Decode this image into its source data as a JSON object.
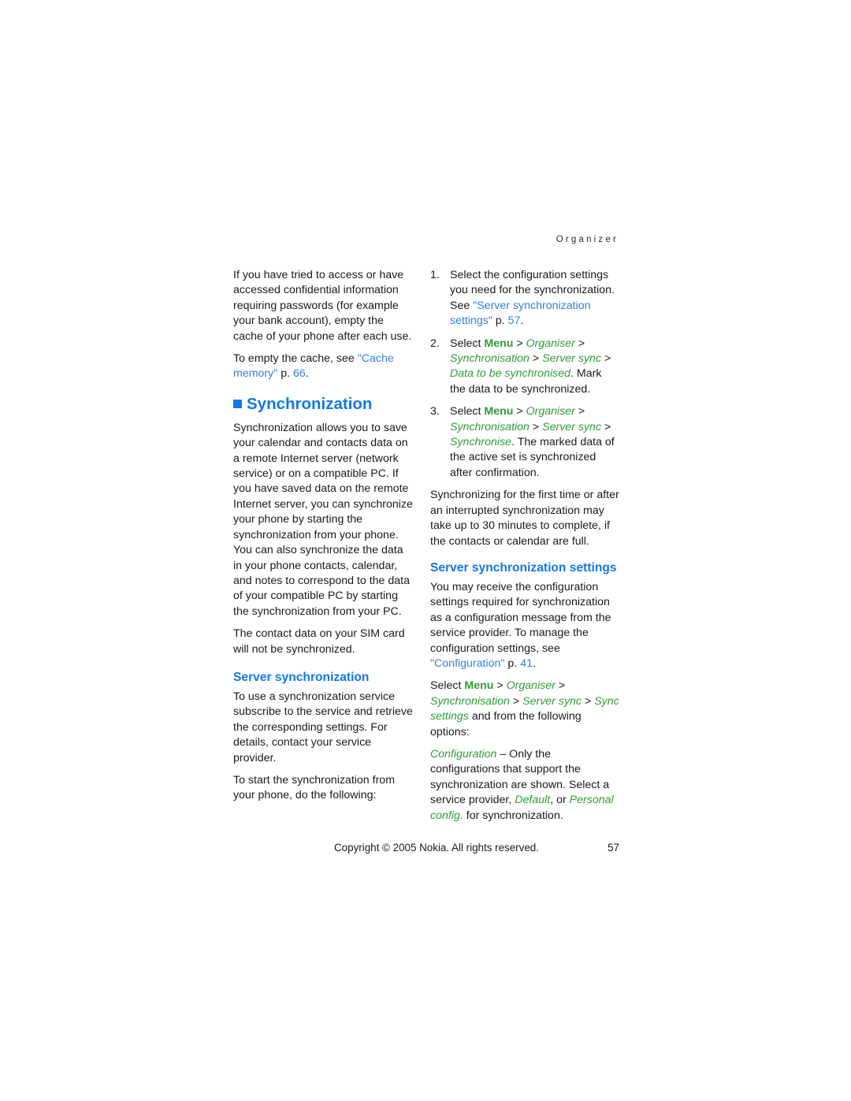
{
  "running_head": "Organizer",
  "colors": {
    "heading_blue": "#1277e8",
    "link_blue": "#3080d8",
    "menu_green": "#2f9b35",
    "body_text": "#1a1a1a",
    "page_background": "#ffffff"
  },
  "left_column": {
    "para_cache_warning": "If you have tried to access or have accessed confidential information requiring passwords (for example your bank account), empty the cache of your phone after each use.",
    "para_empty_cache": {
      "pre": "To empty the cache, see ",
      "link": "\"Cache memory\"",
      "mid": " p. ",
      "page_ref": "66",
      "post": "."
    },
    "chapter_heading": "Synchronization",
    "para_sync_intro": "Synchronization allows you to save your calendar and contacts data on a remote Internet server (network service) or on a compatible PC. If you have saved data on the remote Internet server, you can synchronize your phone by starting the synchronization from your phone. You can also synchronize the data in your phone contacts, calendar, and notes to correspond to the data of your compatible PC by starting the synchronization from your PC.",
    "para_sim_note": "The contact data on your SIM card will not be synchronized.",
    "subheading_server_sync": "Server synchronization",
    "para_subscribe": "To use a synchronization service subscribe to the service and retrieve the corresponding settings. For details, contact your service provider.",
    "para_to_start": "To start the synchronization from your phone, do the following:"
  },
  "right_column": {
    "steps": [
      {
        "number": "1.",
        "pre": "Select the configuration settings you need for the synchronization. See ",
        "link": "\"Server synchronization settings\"",
        "mid": " p. ",
        "page_ref": "57",
        "post": "."
      },
      {
        "number": "2.",
        "pre": "Select ",
        "menu_bold": "Menu",
        "path": [
          "Organiser",
          "Synchronisation",
          "Server sync",
          "Data to be synchronised"
        ],
        "post": ". Mark the data to be synchronized."
      },
      {
        "number": "3.",
        "pre": "Select ",
        "menu_bold": "Menu",
        "path": [
          "Organiser",
          "Synchronisation",
          "Server sync",
          "Synchronise"
        ],
        "post": ". The marked data of the active set is synchronized after confirmation."
      }
    ],
    "para_first_time": "Synchronizing for the first time or after an interrupted synchronization may take up to 30 minutes to complete, if the contacts or calendar are full.",
    "subheading_settings": "Server synchronization settings",
    "para_receive_config": {
      "pre": "You may receive the configuration settings required for synchronization as a configuration message from the service provider. To manage the configuration settings, see ",
      "link": "\"Configuration\"",
      "mid": " p. ",
      "page_ref": "41",
      "post": "."
    },
    "para_select_path": {
      "pre": "Select ",
      "menu_bold": "Menu",
      "path": [
        "Organiser",
        "Synchronisation",
        "Server sync",
        "Sync settings"
      ],
      "post": " and from the following options:"
    },
    "para_configuration_option": {
      "term": "Configuration",
      "dash": " – Only the configurations that support the synchronization are shown. Select a service provider, ",
      "opt1": "Default",
      "mid": ", or ",
      "opt2": "Personal config.",
      "post": " for synchronization."
    }
  },
  "footer": {
    "copyright": "Copyright © 2005 Nokia. All rights reserved.",
    "page_number": "57"
  }
}
